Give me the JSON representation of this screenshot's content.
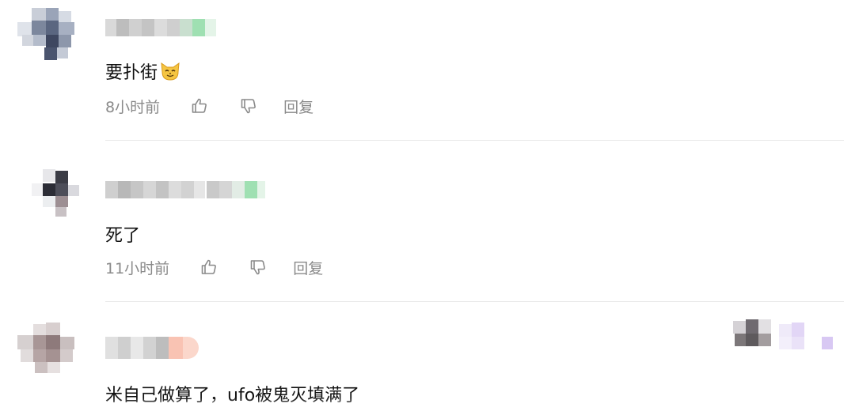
{
  "comments": [
    {
      "text": "要扑街",
      "emoji": "cat-face-emoji",
      "time": "8小时前",
      "reply_label": "回复"
    },
    {
      "text": "死了",
      "time": "11小时前",
      "reply_label": "回复"
    },
    {
      "text": "米自己做算了，ufo被鬼灭填满了"
    }
  ],
  "icons": {
    "like": "thumbs-up-icon",
    "dislike": "thumbs-down-icon"
  },
  "colors": {
    "meta_text": "#8a8a8a",
    "divider": "#e9e9e9",
    "badge_green": "#9fe0b2",
    "badge_peach": "#f9c3b3",
    "badge_lavender": "#e2d6f6"
  }
}
